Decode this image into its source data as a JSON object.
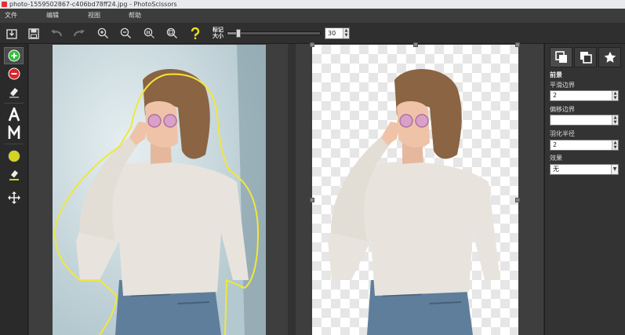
{
  "window": {
    "title": "photo-1559502867-c406bd78ff24.jpg - PhotoScissors"
  },
  "menu": {
    "items": [
      "文件",
      "编辑",
      "视图",
      "帮助"
    ]
  },
  "toolbar": {
    "marker_label_line1": "标记",
    "marker_label_line2": "大小",
    "marker_size": "30",
    "marker_slider_fraction": 0.12
  },
  "side_panel": {
    "section_title": "前景",
    "smooth_label": "平滑边界",
    "smooth_value": "2",
    "offset_label": "偏移边界",
    "offset_value": "",
    "feather_label": "羽化半径",
    "feather_value": "2",
    "effect_label": "效果",
    "effect_value": "无"
  },
  "colors": {
    "foreground_marker": "#2fbf3a",
    "background_marker": "#d9262a",
    "selection_outline": "#f1e73a",
    "marker_color": "#d4d41e"
  }
}
